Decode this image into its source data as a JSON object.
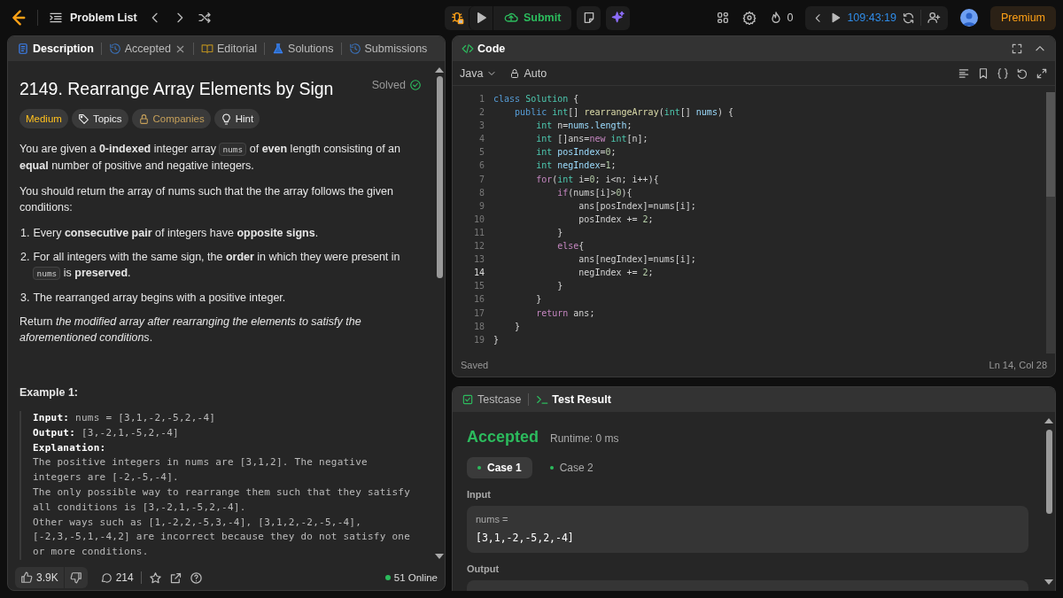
{
  "top_bar": {
    "problem_list": "Problem List",
    "submit": "Submit",
    "streak": "0",
    "timer": "109:43:19",
    "premium": "Premium"
  },
  "description_tabs": [
    {
      "label": "Description",
      "kind": "doc",
      "selected": true,
      "closable": false
    },
    {
      "label": "Accepted",
      "kind": "history",
      "selected": false,
      "closable": true
    },
    {
      "label": "Editorial",
      "kind": "book",
      "selected": false,
      "closable": false
    },
    {
      "label": "Solutions",
      "kind": "flask",
      "selected": false,
      "closable": false
    },
    {
      "label": "Submissions",
      "kind": "history",
      "selected": false,
      "closable": false
    }
  ],
  "problem": {
    "title": "2149. Rearrange Array Elements by Sign",
    "status": "Solved",
    "tags": [
      {
        "label": "Medium",
        "kind": "difficulty"
      },
      {
        "label": "Topics",
        "kind": "topics"
      },
      {
        "label": "Companies",
        "kind": "companies"
      },
      {
        "label": "Hint",
        "kind": "hint"
      }
    ],
    "paragraphs": [
      {
        "kind": "para",
        "segments": [
          {
            "kind": "text",
            "text": "You are given a **0-indexed** integer array "
          },
          {
            "kind": "code",
            "text": "nums"
          },
          {
            "kind": "text",
            "text": " of **even** length consisting of an **equal** number of positive and negative integers."
          }
        ]
      },
      {
        "kind": "para",
        "segments": [
          {
            "kind": "text",
            "text": "You should return the array of nums such that the the array follows the given conditions:"
          }
        ]
      },
      {
        "kind": "item",
        "number": "1.",
        "segments": [
          {
            "kind": "text",
            "text": "Every **consecutive pair** of integers have **opposite signs**."
          }
        ]
      },
      {
        "kind": "item",
        "number": "2.",
        "segments": [
          {
            "kind": "text",
            "text": "For all integers with the same sign, the **order** in which they were present in "
          },
          {
            "kind": "code",
            "text": "nums"
          },
          {
            "kind": "text",
            "text": " is **preserved**."
          }
        ]
      },
      {
        "kind": "item",
        "number": "3.",
        "segments": [
          {
            "kind": "text",
            "text": "The rearranged array begins with a positive integer."
          }
        ]
      },
      {
        "kind": "para",
        "segments": [
          {
            "kind": "text",
            "text": "Return *the modified array after rearranging the elements to satisfy the aforementioned conditions*."
          }
        ]
      }
    ],
    "example": {
      "title": "Example 1:",
      "lines": [
        {
          "text": "**Input:** nums = [3,1,-2,-5,2,-4]",
          "bold": false
        },
        {
          "text": "**Output:** [3,-2,1,-5,2,-4]",
          "bold": false
        },
        {
          "text": "Explanation:",
          "bold": true
        },
        {
          "text": "The positive integers in nums are [3,1,2]. The negative",
          "bold": false
        },
        {
          "text": "integers are [-2,-5,-4].",
          "bold": false
        },
        {
          "text": "The only possible way to rearrange them such that they satisfy",
          "bold": false
        },
        {
          "text": "all conditions is [3,-2,1,-5,2,-4].",
          "bold": false
        },
        {
          "text": "Other ways such as [1,-2,2,-5,3,-4], [3,1,2,-2,-5,-4],",
          "bold": false
        },
        {
          "text": "[-2,3,-5,1,-4,2] are incorrect because they do not satisfy one",
          "bold": false
        },
        {
          "text": "or more conditions.",
          "bold": false
        }
      ]
    }
  },
  "footer": {
    "likes": "3.9K",
    "comments": "214",
    "online": "51 Online"
  },
  "code": {
    "title": "Code",
    "language": "Java",
    "mode": "Auto",
    "status": "Saved",
    "cursor": "Ln 14, Col 28",
    "lines": [
      {
        "number": "1",
        "active": false,
        "tokens": [
          {
            "kind": "keyword",
            "text": "class"
          },
          {
            "kind": "type",
            "text": " Solution"
          },
          {
            "kind": "plain",
            "text": " {"
          }
        ]
      },
      {
        "number": "2",
        "active": false,
        "tokens": [
          {
            "kind": "keyword",
            "text": "    public"
          },
          {
            "kind": "type",
            "text": " int"
          },
          {
            "kind": "plain",
            "text": "[] "
          },
          {
            "kind": "function",
            "text": "rearrangeArray"
          },
          {
            "kind": "plain",
            "text": "("
          },
          {
            "kind": "type",
            "text": "int"
          },
          {
            "kind": "plain",
            "text": "[] "
          },
          {
            "kind": "variable",
            "text": "nums"
          },
          {
            "kind": "plain",
            "text": ") {"
          }
        ]
      },
      {
        "number": "3",
        "active": false,
        "tokens": [
          {
            "kind": "type",
            "text": "        int"
          },
          {
            "kind": "plain",
            "text": " n="
          },
          {
            "kind": "variable",
            "text": "nums.length"
          },
          {
            "kind": "plain",
            "text": ";"
          }
        ]
      },
      {
        "number": "4",
        "active": false,
        "tokens": [
          {
            "kind": "type",
            "text": "        int"
          },
          {
            "kind": "plain",
            "text": " []ans="
          },
          {
            "kind": "control",
            "text": "new"
          },
          {
            "kind": "type",
            "text": " int"
          },
          {
            "kind": "plain",
            "text": "[n];"
          }
        ]
      },
      {
        "number": "5",
        "active": false,
        "tokens": [
          {
            "kind": "type",
            "text": "        int"
          },
          {
            "kind": "variable",
            "text": " posIndex"
          },
          {
            "kind": "plain",
            "text": "="
          },
          {
            "kind": "number",
            "text": "0"
          },
          {
            "kind": "plain",
            "text": ";"
          }
        ]
      },
      {
        "number": "6",
        "active": false,
        "tokens": [
          {
            "kind": "type",
            "text": "        int"
          },
          {
            "kind": "variable",
            "text": " negIndex"
          },
          {
            "kind": "plain",
            "text": "="
          },
          {
            "kind": "number",
            "text": "1"
          },
          {
            "kind": "plain",
            "text": ";"
          }
        ]
      },
      {
        "number": "7",
        "active": false,
        "tokens": [
          {
            "kind": "control",
            "text": "        for"
          },
          {
            "kind": "plain",
            "text": "("
          },
          {
            "kind": "type",
            "text": "int"
          },
          {
            "kind": "plain",
            "text": " i="
          },
          {
            "kind": "number",
            "text": "0"
          },
          {
            "kind": "plain",
            "text": "; i<n; i++){"
          }
        ]
      },
      {
        "number": "8",
        "active": false,
        "tokens": [
          {
            "kind": "control",
            "text": "            if"
          },
          {
            "kind": "plain",
            "text": "(nums[i]>"
          },
          {
            "kind": "number",
            "text": "0"
          },
          {
            "kind": "plain",
            "text": "){"
          }
        ]
      },
      {
        "number": "9",
        "active": false,
        "tokens": [
          {
            "kind": "plain",
            "text": "                ans[posIndex]=nums[i];"
          }
        ]
      },
      {
        "number": "10",
        "active": false,
        "tokens": [
          {
            "kind": "plain",
            "text": "                posIndex += "
          },
          {
            "kind": "number",
            "text": "2"
          },
          {
            "kind": "plain",
            "text": ";"
          }
        ]
      },
      {
        "number": "11",
        "active": false,
        "tokens": [
          {
            "kind": "plain",
            "text": "            }"
          }
        ]
      },
      {
        "number": "12",
        "active": false,
        "tokens": [
          {
            "kind": "control",
            "text": "            else"
          },
          {
            "kind": "plain",
            "text": "{"
          }
        ]
      },
      {
        "number": "13",
        "active": false,
        "tokens": [
          {
            "kind": "plain",
            "text": "                ans[negIndex]=nums[i];"
          }
        ]
      },
      {
        "number": "14",
        "active": true,
        "tokens": [
          {
            "kind": "plain",
            "text": "                negIndex += "
          },
          {
            "kind": "number",
            "text": "2"
          },
          {
            "kind": "plain",
            "text": ";"
          }
        ]
      },
      {
        "number": "15",
        "active": false,
        "tokens": [
          {
            "kind": "plain",
            "text": "            }"
          }
        ]
      },
      {
        "number": "16",
        "active": false,
        "tokens": [
          {
            "kind": "plain",
            "text": "        }"
          }
        ]
      },
      {
        "number": "17",
        "active": false,
        "tokens": [
          {
            "kind": "control",
            "text": "        return"
          },
          {
            "kind": "plain",
            "text": " ans;"
          }
        ]
      },
      {
        "number": "18",
        "active": false,
        "tokens": [
          {
            "kind": "plain",
            "text": "    }"
          }
        ]
      },
      {
        "number": "19",
        "active": false,
        "tokens": [
          {
            "kind": "plain",
            "text": "}"
          }
        ]
      }
    ]
  },
  "result": {
    "tabs": [
      {
        "label": "Testcase",
        "kind": "testcase",
        "selected": false
      },
      {
        "label": "Test Result",
        "kind": "terminal",
        "selected": true
      }
    ],
    "verdict": "Accepted",
    "runtime": "Runtime: 0 ms",
    "cases": [
      {
        "label": "Case 1",
        "selected": true
      },
      {
        "label": "Case 2",
        "selected": false
      }
    ],
    "input_label": "Input",
    "inputs": [
      {
        "name": "nums =",
        "value": "[3,1,-2,-5,2,-4]"
      }
    ],
    "output_label": "Output"
  }
}
